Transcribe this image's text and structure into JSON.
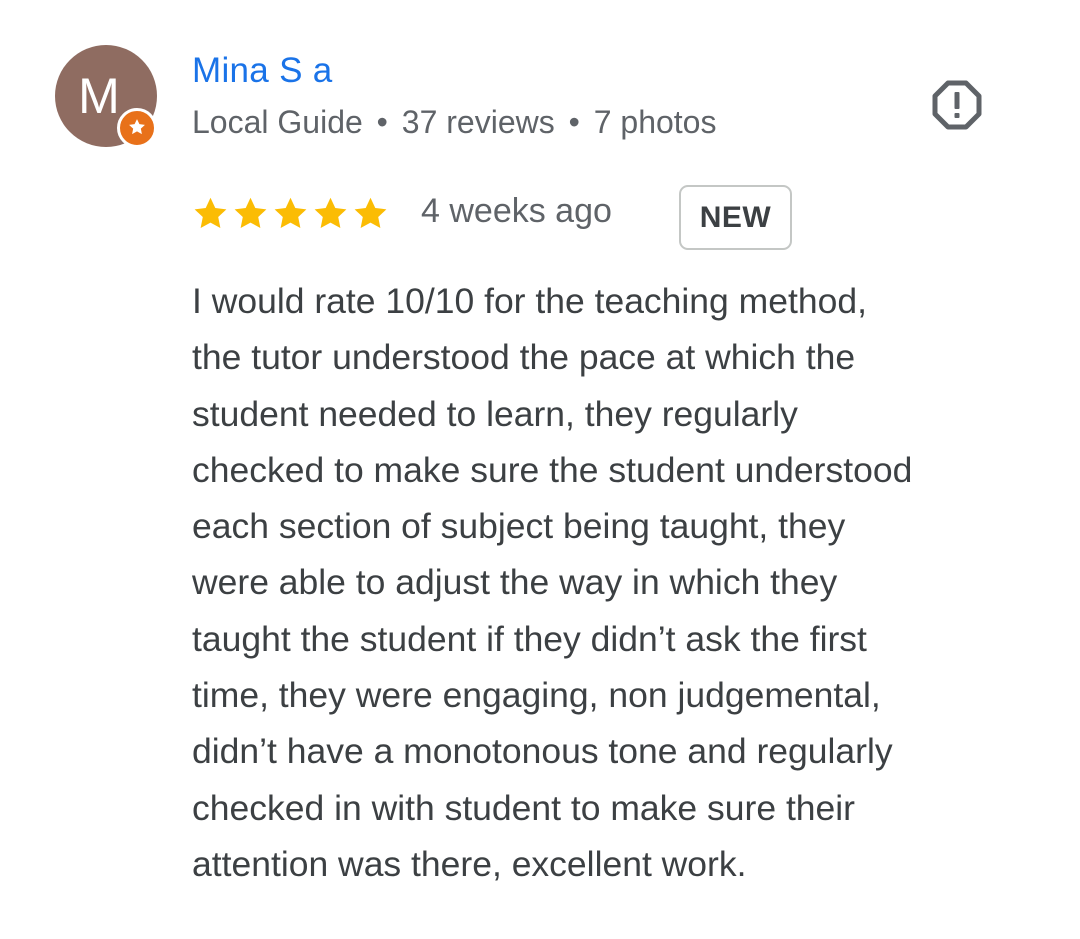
{
  "reviewer": {
    "initial": "M",
    "name": "Mina S a",
    "badge_icon": "local-guide-star-icon",
    "meta": {
      "role": "Local Guide",
      "separator": "•",
      "reviews": "37 reviews",
      "photos": "7 photos"
    }
  },
  "report_icon": "report-octagon-exclamation-icon",
  "rating": {
    "stars": 5,
    "max_stars": 5,
    "star_icon": "star-icon",
    "star_color": "#fbbc04"
  },
  "time_ago": "4 weeks ago",
  "new_badge": "NEW",
  "review_lines": [
    "I would rate 10/10 for the teaching method,",
    "the tutor understood the pace at which the",
    "student needed to learn, they regularly",
    "checked to make sure the student understood",
    "each section of subject being taught, they",
    "were able to adjust the way in which they",
    "taught the student if they didn’t ask the first",
    "time, they were engaging, non judgemental,",
    "didn’t have a monotonous tone and regularly",
    "checked in with student to make sure their",
    "attention was there, excellent work."
  ],
  "colors": {
    "name": "#1a73e8",
    "avatar_bg": "#8f6c61",
    "guide_badge": "#e8711a",
    "meta_text": "#5f6368",
    "body_text": "#3c4043"
  }
}
